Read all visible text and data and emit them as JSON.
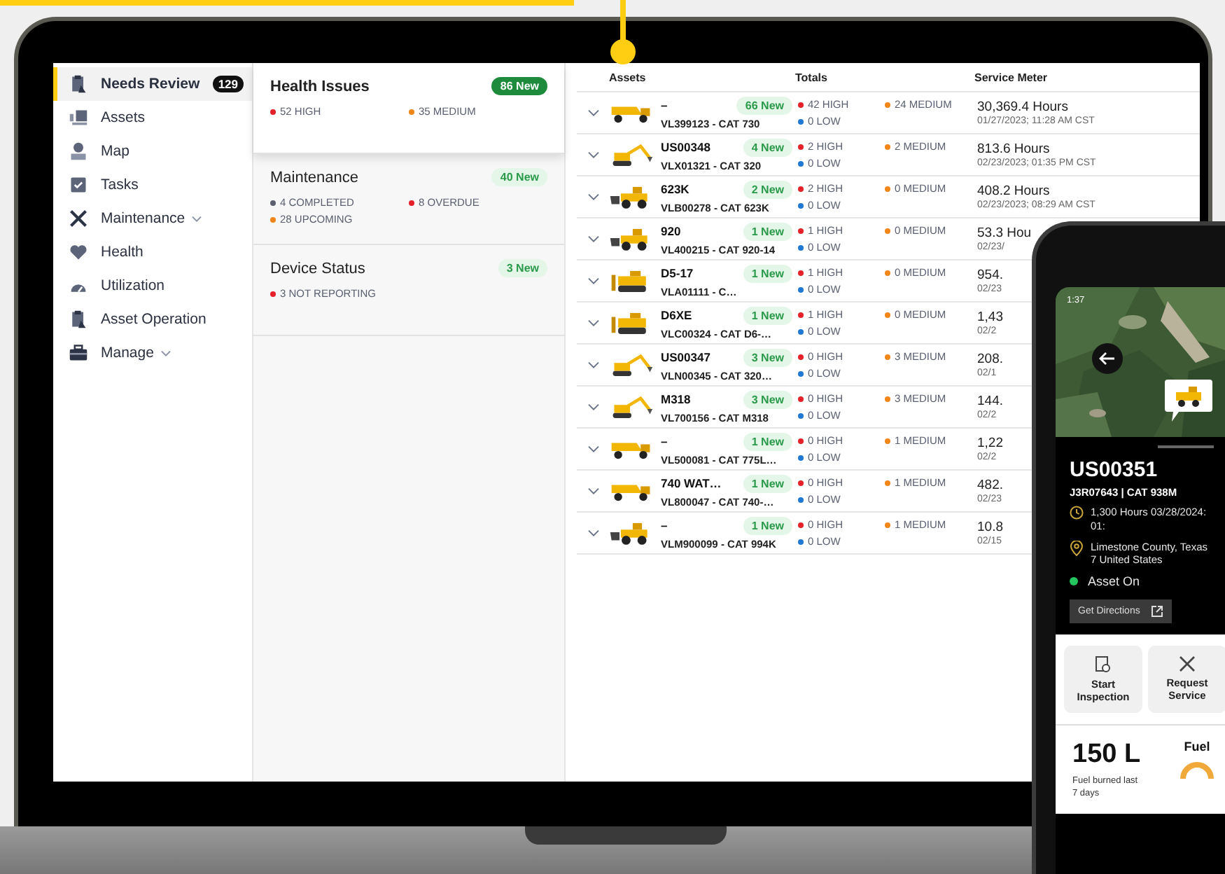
{
  "sidebar": {
    "items": [
      {
        "label": "Needs Review",
        "selected": true,
        "badge": "129",
        "has_submenu": false
      },
      {
        "label": "Assets",
        "selected": false,
        "has_submenu": false
      },
      {
        "label": "Map",
        "selected": false,
        "has_submenu": false
      },
      {
        "label": "Tasks",
        "selected": false,
        "has_submenu": false
      },
      {
        "label": "Maintenance",
        "selected": false,
        "has_submenu": true
      },
      {
        "label": "Health",
        "selected": false,
        "has_submenu": false
      },
      {
        "label": "Utilization",
        "selected": false,
        "has_submenu": false
      },
      {
        "label": "Asset Operation",
        "selected": false,
        "has_submenu": false
      },
      {
        "label": "Manage",
        "selected": false,
        "has_submenu": true
      }
    ]
  },
  "summary_cards": [
    {
      "title": "Health Issues",
      "badge": "86 New",
      "selected": true,
      "stats": [
        {
          "label": "52 HIGH",
          "color": "#e5202b"
        },
        {
          "label": "35 MEDIUM",
          "color": "#f0861a"
        }
      ]
    },
    {
      "title": "Maintenance",
      "badge": "40 New",
      "selected": false,
      "stats": [
        {
          "label": "4 COMPLETED",
          "color": "#5a6070"
        },
        {
          "label": "8 OVERDUE",
          "color": "#e5202b"
        },
        {
          "label": "28 UPCOMING",
          "color": "#f0861a"
        }
      ]
    },
    {
      "title": "Device Status",
      "badge": "3 New",
      "selected": false,
      "stats": [
        {
          "label": "3 NOT REPORTING",
          "color": "#e5202b"
        }
      ]
    }
  ],
  "assets_table": {
    "columns": [
      "Assets",
      "Totals",
      "Service Meter"
    ],
    "rows": [
      {
        "kind": "truck",
        "name": "–",
        "badge": "66 New",
        "model": "VL399123 - CAT 730",
        "totals": [
          {
            "label": "42 HIGH",
            "color": "#e5202b"
          },
          {
            "label": "24 MEDIUM",
            "color": "#f0861a"
          },
          {
            "label": "0 LOW",
            "color": "#1f78d1"
          }
        ],
        "hours": "30,369.4 Hours",
        "date": "01/27/2023; 11:28 AM CST"
      },
      {
        "kind": "excavator",
        "name": "US00348",
        "badge": "4 New",
        "model": "VLX01321 - CAT 320",
        "totals": [
          {
            "label": "2 HIGH",
            "color": "#e5202b"
          },
          {
            "label": "2 MEDIUM",
            "color": "#f0861a"
          },
          {
            "label": "0 LOW",
            "color": "#1f78d1"
          }
        ],
        "hours": "813.6 Hours",
        "date": "02/23/2023; 01:35 PM CST"
      },
      {
        "kind": "loader",
        "name": "623K",
        "badge": "2 New",
        "model": "VLB00278 - CAT 623K",
        "totals": [
          {
            "label": "2 HIGH",
            "color": "#e5202b"
          },
          {
            "label": "0 MEDIUM",
            "color": "#f0861a"
          },
          {
            "label": "0 LOW",
            "color": "#1f78d1"
          }
        ],
        "hours": "408.2 Hours",
        "date": "02/23/2023; 08:29 AM CST"
      },
      {
        "kind": "loader",
        "name": "920",
        "badge": "1 New",
        "model": "VL400215 - CAT 920-14",
        "totals": [
          {
            "label": "1 HIGH",
            "color": "#e5202b"
          },
          {
            "label": "0 MEDIUM",
            "color": "#f0861a"
          },
          {
            "label": "0 LOW",
            "color": "#1f78d1"
          }
        ],
        "hours": "53.3 Hou",
        "date": "02/23/"
      },
      {
        "kind": "dozer",
        "name": "D5-17",
        "badge": "1 New",
        "model": "VLA01111 - C…",
        "totals": [
          {
            "label": "1 HIGH",
            "color": "#e5202b"
          },
          {
            "label": "0 MEDIUM",
            "color": "#f0861a"
          },
          {
            "label": "0 LOW",
            "color": "#1f78d1"
          }
        ],
        "hours": "954.",
        "date": "02/23"
      },
      {
        "kind": "dozer",
        "name": "D6XE",
        "badge": "1 New",
        "model": "VLC00324 - CAT D6-…",
        "totals": [
          {
            "label": "1 HIGH",
            "color": "#e5202b"
          },
          {
            "label": "0 MEDIUM",
            "color": "#f0861a"
          },
          {
            "label": "0 LOW",
            "color": "#1f78d1"
          }
        ],
        "hours": "1,43",
        "date": "02/2"
      },
      {
        "kind": "excavator",
        "name": "US00347",
        "badge": "3 New",
        "model": "VLN00345 - CAT 320…",
        "totals": [
          {
            "label": "0 HIGH",
            "color": "#e5202b"
          },
          {
            "label": "3 MEDIUM",
            "color": "#f0861a"
          },
          {
            "label": "0 LOW",
            "color": "#1f78d1"
          }
        ],
        "hours": "208.",
        "date": "02/1"
      },
      {
        "kind": "excavator",
        "name": "M318",
        "badge": "3 New",
        "model": "VL700156 - CAT M318",
        "totals": [
          {
            "label": "0 HIGH",
            "color": "#e5202b"
          },
          {
            "label": "3 MEDIUM",
            "color": "#f0861a"
          },
          {
            "label": "0 LOW",
            "color": "#1f78d1"
          }
        ],
        "hours": "144.",
        "date": "02/2"
      },
      {
        "kind": "truck",
        "name": "–",
        "badge": "1 New",
        "model": "VL500081 - CAT 775L…",
        "totals": [
          {
            "label": "0 HIGH",
            "color": "#e5202b"
          },
          {
            "label": "1 MEDIUM",
            "color": "#f0861a"
          },
          {
            "label": "0 LOW",
            "color": "#1f78d1"
          }
        ],
        "hours": "1,22",
        "date": "02/2"
      },
      {
        "kind": "truck",
        "name": "740 WAT…",
        "badge": "1 New",
        "model": "VL800047 - CAT 740-…",
        "totals": [
          {
            "label": "0 HIGH",
            "color": "#e5202b"
          },
          {
            "label": "1 MEDIUM",
            "color": "#f0861a"
          },
          {
            "label": "0 LOW",
            "color": "#1f78d1"
          }
        ],
        "hours": "482.",
        "date": "02/23"
      },
      {
        "kind": "loader",
        "name": "–",
        "badge": "1 New",
        "model": "VLM900099 - CAT 994K",
        "totals": [
          {
            "label": "0 HIGH",
            "color": "#e5202b"
          },
          {
            "label": "1 MEDIUM",
            "color": "#f0861a"
          },
          {
            "label": "0 LOW",
            "color": "#1f78d1"
          }
        ],
        "hours": "10.8",
        "date": "02/15"
      }
    ]
  },
  "phone": {
    "time": "1:37",
    "asset_name": "US00351",
    "subtitle": "J3R07643 | CAT 938M",
    "hours": "1,300 Hours 03/28/2024: 01:",
    "location": "Limestone County, Texas 7 United States",
    "status": {
      "label": "Asset On",
      "on": true
    },
    "directions_button": "Get Directions",
    "actions": [
      {
        "label": "Start Inspection"
      },
      {
        "label": "Request Service"
      }
    ],
    "fuel": {
      "value": "150 L",
      "caption": "Fuel burned last 7 days",
      "title": "Fuel"
    }
  }
}
